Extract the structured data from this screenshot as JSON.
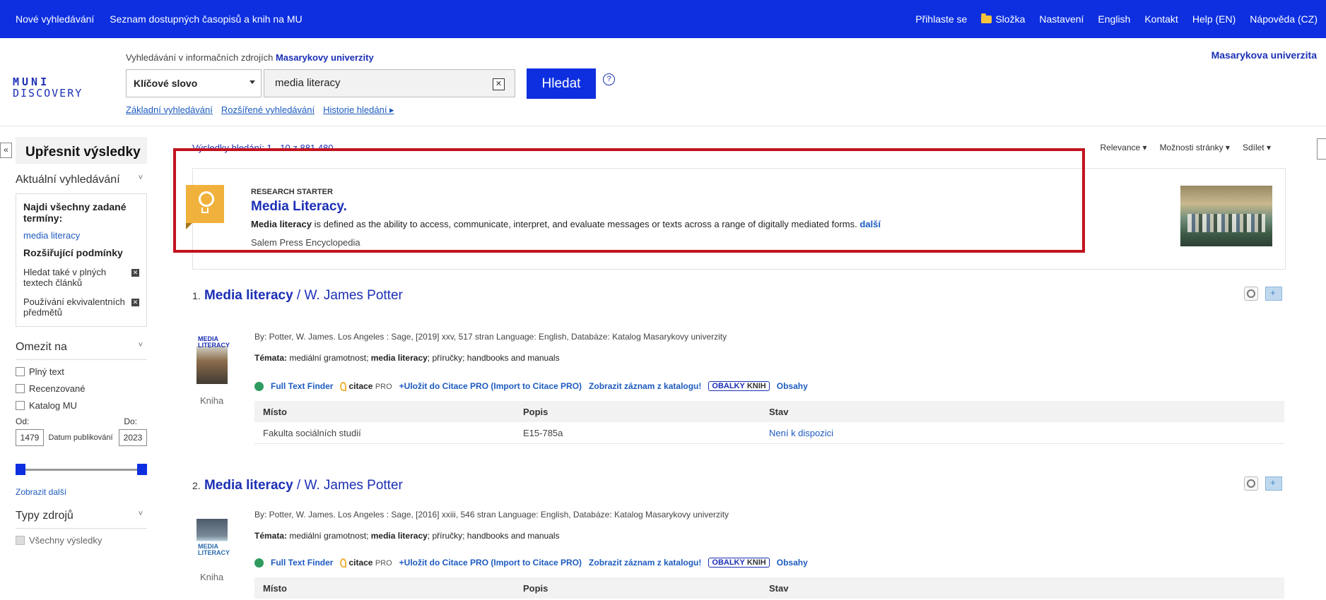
{
  "topnav": {
    "left": [
      "Nové vyhledávání",
      "Seznam dostupných časopisů a knih na MU"
    ],
    "signin": "Přihlaste se",
    "folder": "Složka",
    "right": [
      "Nastavení",
      "English",
      "Kontakt",
      "Help (EN)",
      "Nápověda (CZ)"
    ]
  },
  "header": {
    "logo_line1": "MUNI",
    "logo_line2": "DISCOVERY",
    "lead_prefix": "Vyhledávání v informačních zdrojích",
    "lead_inst": "Masarykovy univerzity",
    "scope_value": "Klíčové slovo",
    "query_value": "media literacy",
    "clear_label": "✕",
    "search_label": "Hledat",
    "help_label": "?",
    "links": [
      "Základní vyhledávání",
      "Rozšířené vyhledávání",
      "Historie hledání ▸"
    ],
    "institution": "Masarykova univerzita"
  },
  "sidebar": {
    "collapse": "«",
    "title": "Upřesnit výsledky",
    "current_heading": "Aktuální vyhledávání",
    "find_all": "Najdi všechny zadané termíny:",
    "term": "media literacy",
    "expanders_heading": "Rozšiřující podmínky",
    "conditions": [
      "Hledat také v plných textech článků",
      "Používání ekvivalentních předmětů"
    ],
    "limit_heading": "Omezit na",
    "limits": [
      "Plný text",
      "Recenzované",
      "Katalog MU"
    ],
    "date_from_label": "Od:",
    "date_to_label": "Do:",
    "date_from": "1479",
    "date_to": "2023",
    "date_caption": "Datum publikování",
    "show_more": "Zobrazit další",
    "types_heading": "Typy zdrojů",
    "all_results": "Všechny výsledky",
    "chev": "˅",
    "remove": "✕"
  },
  "main": {
    "results_count": "Výsledky hledání: 1 - 10 z 881.480",
    "toolbar": [
      "Relevance",
      "Možnosti stránky",
      "Sdílet"
    ]
  },
  "research_starter": {
    "label": "RESEARCH STARTER",
    "title": "Media Literacy.",
    "desc_bold": "Media literacy",
    "desc_rest": " is defined as the ability to access, communicate, interpret, and evaluate messages or texts across a range of digitally mediated forms. ",
    "more": "další",
    "source": "Salem Press Encyclopedia"
  },
  "records": [
    {
      "num": "1.",
      "title_bold": "Media literacy",
      "title_rest": " / W. James Potter",
      "cover_text": "MEDIA LITERACY",
      "type": "Kniha",
      "meta": "By: Potter, W. James. Los Angeles : Sage, [2019] xxv, 517 stran Language: English, Databáze: Katalog Masarykovy univerzity",
      "subjects_label": "Témata:",
      "subjects_pre": " mediální gramotnost; ",
      "subjects_bold": "media literacy",
      "subjects_post": "; příručky; handbooks and manuals",
      "holding": {
        "misto": "Fakulta sociálních studií",
        "popis": "E15-785a",
        "stav": "Není k dispozici"
      }
    },
    {
      "num": "2.",
      "title_bold": "Media literacy",
      "title_rest": " / W. James Potter",
      "cover_text": "MEDIA LITERACY",
      "type": "Kniha",
      "meta": "By: Potter, W. James. Los Angeles : Sage, [2016] xxiii, 546 stran Language: English, Databáze: Katalog Masarykovy univerzity",
      "subjects_label": "Témata:",
      "subjects_pre": " mediální gramotnost; ",
      "subjects_bold": "media literacy",
      "subjects_post": "; příručky; handbooks and manuals"
    }
  ],
  "actions": {
    "fulltext": "Full Text Finder",
    "citace": "citace",
    "citace_pro": "PRO",
    "save": "+Uložit do Citace PRO (Import to Citace PRO)",
    "catalog": "Zobrazit záznam z katalogu!",
    "obalky": "OBALKY",
    "knih": "KNIH",
    "obsahy": "Obsahy"
  },
  "holdings_headers": {
    "misto": "Místo",
    "popis": "Popis",
    "stav": "Stav"
  }
}
